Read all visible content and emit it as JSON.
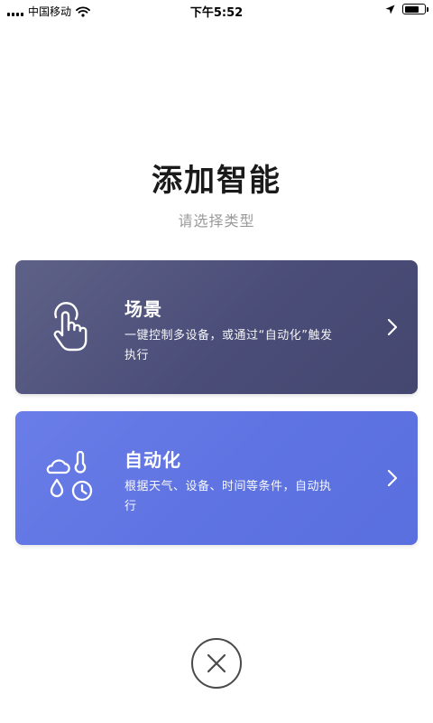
{
  "status_bar": {
    "carrier": "中国移动",
    "time": "下午5:52",
    "battery_level": 0.75,
    "icons": [
      "signal-icon",
      "wifi-icon",
      "location-arrow-icon",
      "battery-icon"
    ]
  },
  "header": {
    "title": "添加智能",
    "subtitle": "请选择类型"
  },
  "cards": [
    {
      "title": "场景",
      "description": "一键控制多设备，或通过“自动化”触发执行",
      "icon": "hand-tap-icon",
      "color": "#4d507a"
    },
    {
      "title": "自动化",
      "description": "根据天气、设备、时间等条件，自动执行",
      "icon": "weather-time-icon",
      "color": "#6276e3"
    }
  ],
  "close": {
    "icon": "close-icon"
  }
}
